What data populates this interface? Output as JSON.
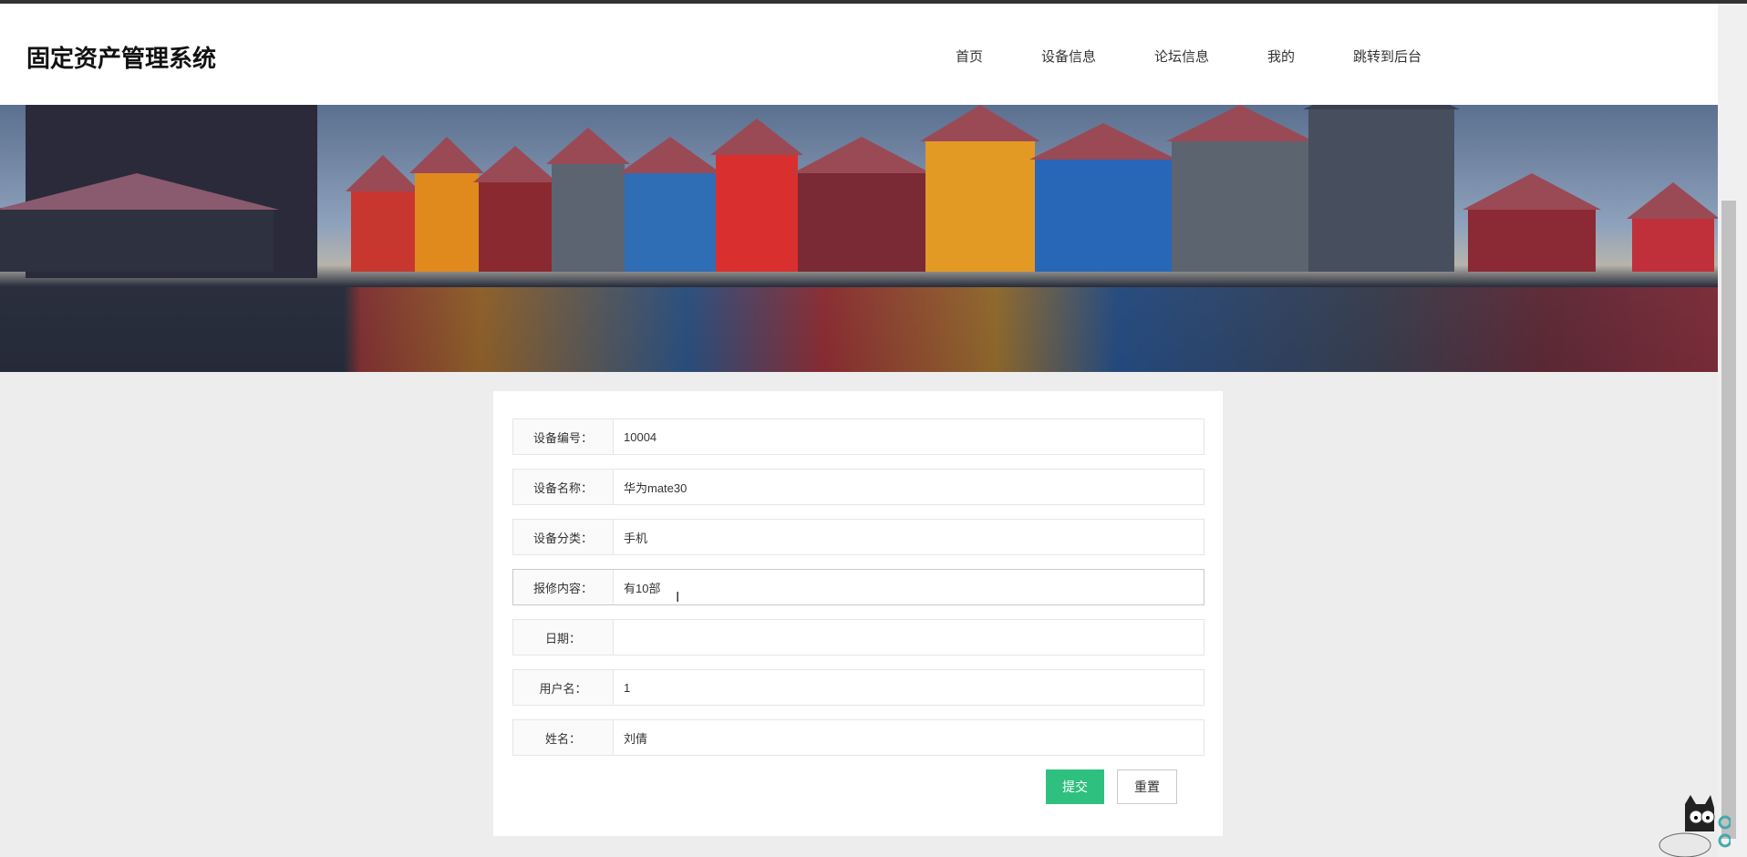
{
  "header": {
    "title": "固定资产管理系统",
    "nav": [
      "首页",
      "设备信息",
      "论坛信息",
      "我的",
      "跳转到后台"
    ]
  },
  "form": {
    "fields": [
      {
        "label": "设备编号：",
        "value": "10004"
      },
      {
        "label": "设备名称：",
        "value": "华为mate30"
      },
      {
        "label": "设备分类：",
        "value": "手机"
      },
      {
        "label": "报修内容：",
        "value": "有10部"
      },
      {
        "label": "日期：",
        "value": ""
      },
      {
        "label": "用户名：",
        "value": "1"
      },
      {
        "label": "姓名：",
        "value": "刘倩"
      }
    ],
    "submit_label": "提交",
    "reset_label": "重置"
  },
  "colors": {
    "accent": "#2ec07f",
    "background": "#ededed"
  }
}
